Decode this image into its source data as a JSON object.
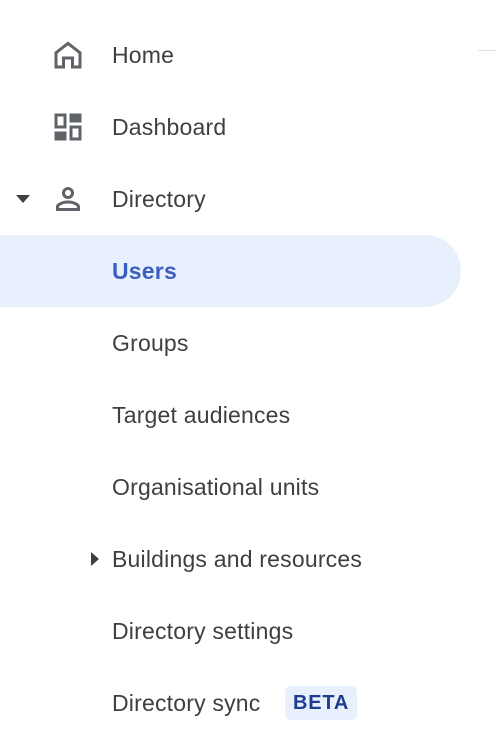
{
  "nav": {
    "home": {
      "label": "Home",
      "icon": "home-icon"
    },
    "dashboard": {
      "label": "Dashboard",
      "icon": "dashboard-icon"
    },
    "directory": {
      "label": "Directory",
      "icon": "person-icon",
      "expanded": true
    },
    "users": {
      "label": "Users",
      "selected": true
    },
    "groups": {
      "label": "Groups"
    },
    "target_audiences": {
      "label": "Target audiences"
    },
    "organisational_units": {
      "label": "Organisational units"
    },
    "buildings_and_resources": {
      "label": "Buildings and resources",
      "expanded": false
    },
    "directory_settings": {
      "label": "Directory settings"
    },
    "directory_sync": {
      "label": "Directory sync",
      "badge": "BETA"
    }
  },
  "colors": {
    "text": "#3c4043",
    "icon": "#5f6368",
    "selected_bg": "#e8f0fe",
    "selected_text": "#3b5fc0",
    "badge_text": "#1f3d8f"
  }
}
